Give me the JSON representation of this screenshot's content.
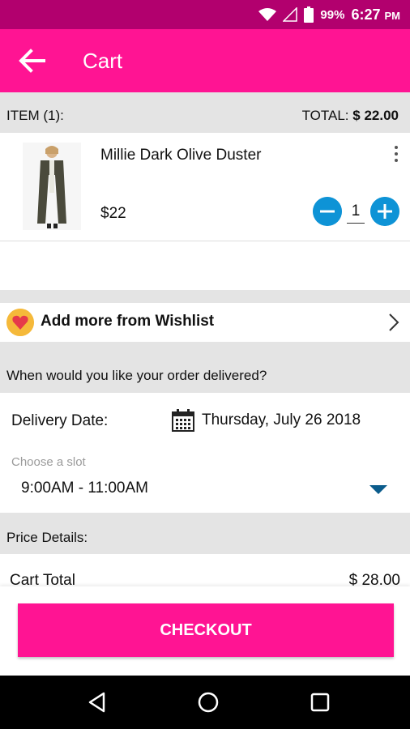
{
  "status_bar": {
    "battery": "99%",
    "time": "6:27",
    "ampm": "PM"
  },
  "app_bar": {
    "title": "Cart"
  },
  "summary": {
    "items_label": "ITEM (1):",
    "total_label": "TOTAL:",
    "total_value": "$ 22.00"
  },
  "cart_items": [
    {
      "name": "Millie Dark Olive Duster",
      "price": "$22",
      "quantity": "1"
    }
  ],
  "wishlist": {
    "label": "Add more from Wishlist"
  },
  "delivery": {
    "question": "When would you like your order delivered?",
    "date_label": "Delivery Date:",
    "date_value": "Thursday, July 26 2018",
    "slot_hint": "Choose a slot",
    "slot_value": "9:00AM - 11:00AM"
  },
  "price_details": {
    "heading": "Price Details:",
    "cart_total_label": "Cart Total",
    "cart_total_value": "$ 28.00"
  },
  "checkout": {
    "label": "CHECKOUT"
  },
  "colors": {
    "brand_pink": "#ff1493",
    "status_bar": "#b2006e",
    "qty_button": "#0e93d6"
  }
}
